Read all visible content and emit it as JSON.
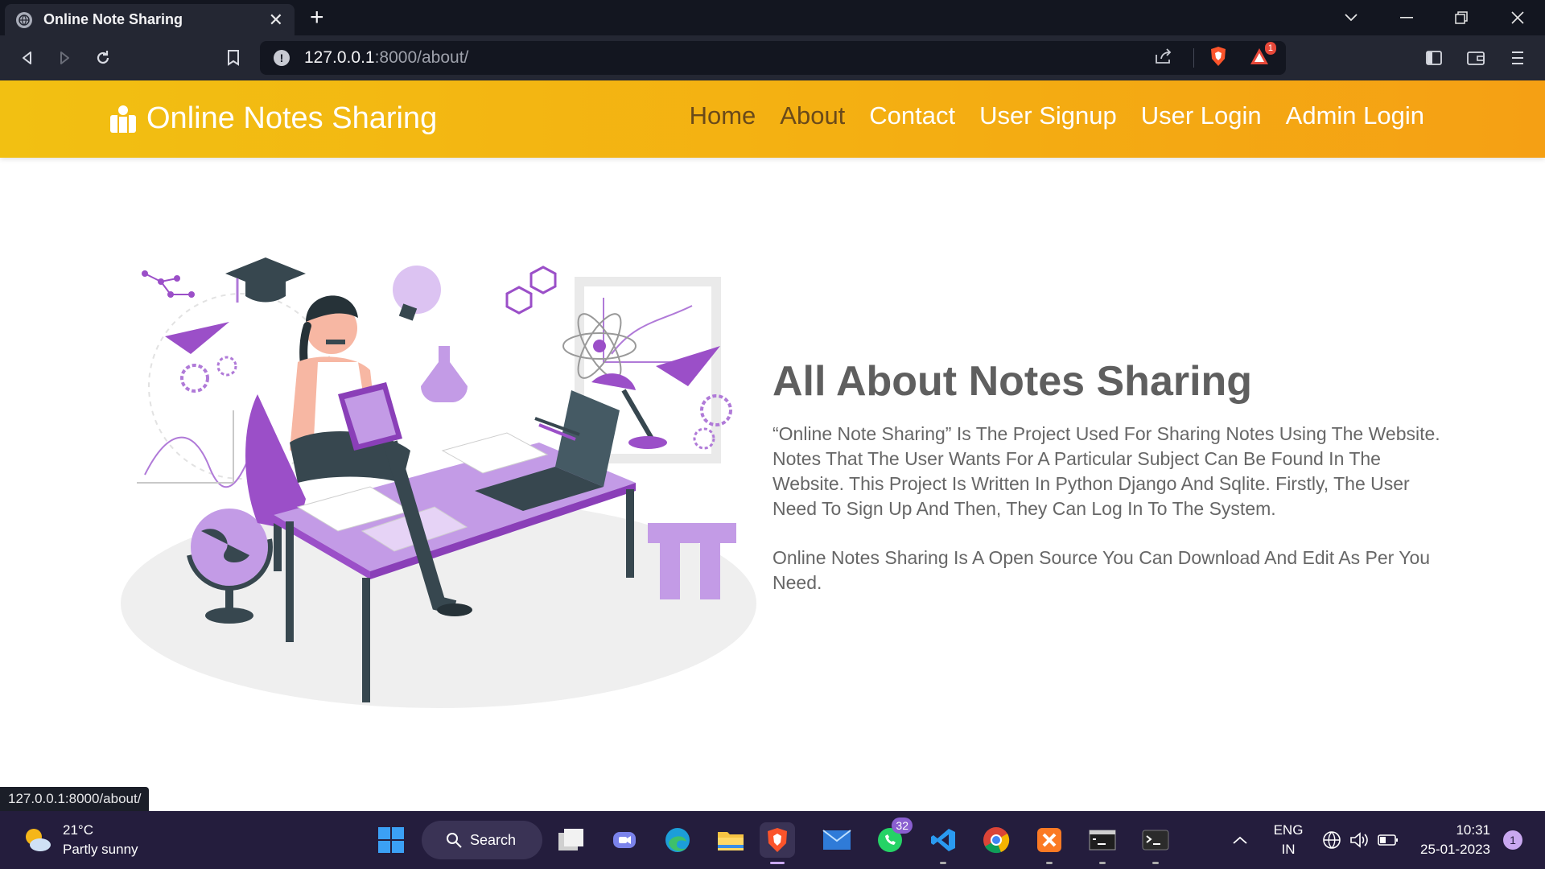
{
  "browser": {
    "tab_title": "Online Note Sharing",
    "url_host": "127.0.0.1",
    "url_path": ":8000/about/",
    "status_url": "127.0.0.1:8000/about/",
    "brave_badge": "1"
  },
  "site": {
    "brand": "Online Notes Sharing",
    "nav": [
      "Home",
      "About",
      "Contact",
      "User Signup",
      "User Login",
      "Admin Login"
    ]
  },
  "about": {
    "title": "All About Notes Sharing",
    "para1": "“Online Note Sharing” Is The Project Used For Sharing Notes Using The Website. Notes That The User Wants For A Particular Subject Can Be Found In The Website. This Project Is Written In Python Django And Sqlite. Firstly, The User Need To Sign Up And Then, They Can Log In To The System.",
    "para2": "Online Notes Sharing Is A Open Source You Can Download And Edit As Per You Need."
  },
  "taskbar": {
    "weather_temp": "21°C",
    "weather_desc": "Partly sunny",
    "search_label": "Search",
    "whatsapp_badge": "32",
    "lang_line1": "ENG",
    "lang_line2": "IN",
    "time": "10:31",
    "date": "25-01-2023",
    "notification_count": "1"
  },
  "colors": {
    "navbar_start": "#f2c012",
    "navbar_end": "#f5a014",
    "accent_purple": "#9b4fc8"
  }
}
